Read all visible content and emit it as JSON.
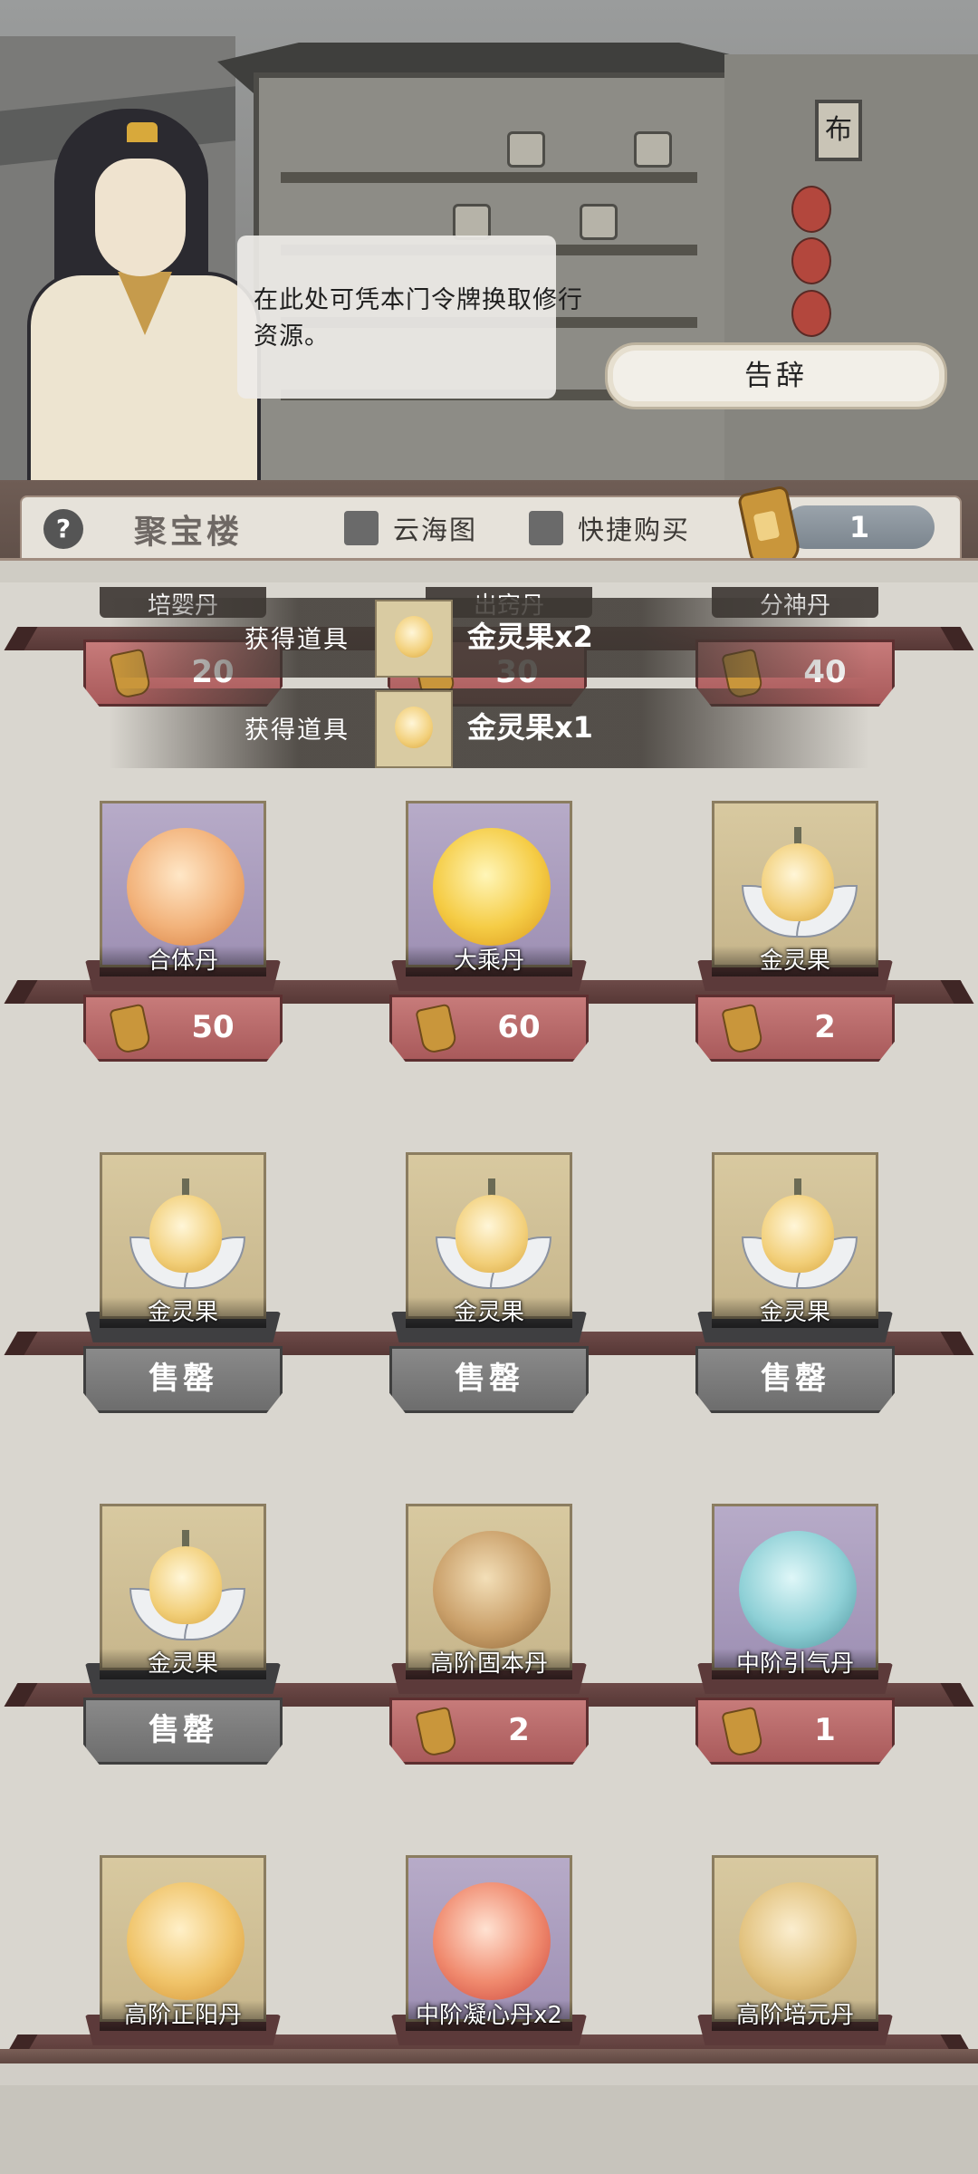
{
  "dialog": {
    "text": "在此处可凭本门令牌换取修行资源。"
  },
  "leave_button": "告辞",
  "header": {
    "help_icon": "question-icon",
    "title": "聚宝楼",
    "checkbox1": "云海图",
    "checkbox2": "快捷购买",
    "token_count": "1"
  },
  "toasts": [
    {
      "label": "获得道具",
      "item": "金灵果x2"
    },
    {
      "label": "获得道具",
      "item": "金灵果x1"
    }
  ],
  "top_partial": {
    "names": [
      "培婴丹",
      "出窍丹",
      "分神丹"
    ],
    "prices": [
      "20",
      "30",
      "40"
    ]
  },
  "rows": [
    [
      {
        "name": "合体丹",
        "price": "50",
        "sold": ""
      },
      {
        "name": "大乘丹",
        "price": "60",
        "sold": ""
      },
      {
        "name": "金灵果",
        "price": "2",
        "sold": ""
      }
    ],
    [
      {
        "name": "金灵果",
        "price": "",
        "sold": "售罄"
      },
      {
        "name": "金灵果",
        "price": "",
        "sold": "售罄"
      },
      {
        "name": "金灵果",
        "price": "",
        "sold": "售罄"
      }
    ],
    [
      {
        "name": "金灵果",
        "price": "",
        "sold": "售罄"
      },
      {
        "name": "高阶固本丹",
        "price": "2",
        "sold": ""
      },
      {
        "name": "中阶引气丹",
        "price": "1",
        "sold": ""
      }
    ],
    [
      {
        "name": "高阶正阳丹",
        "price": "",
        "sold": ""
      },
      {
        "name": "中阶凝心丹x2",
        "price": "",
        "sold": ""
      },
      {
        "name": "高阶培元丹",
        "price": "",
        "sold": ""
      }
    ]
  ],
  "scene": {
    "shop_sign": "布"
  }
}
